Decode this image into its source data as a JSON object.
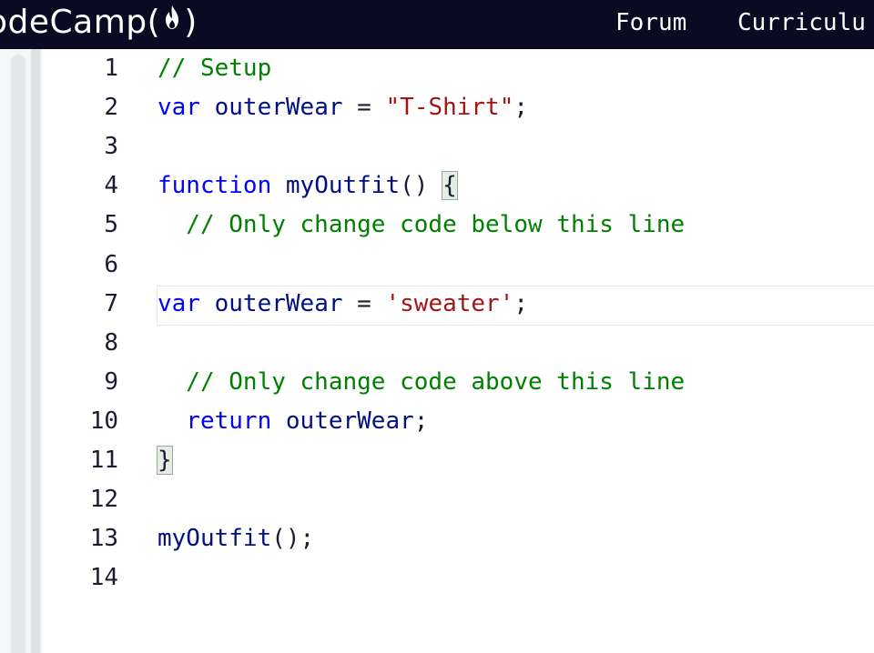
{
  "navbar": {
    "brand_text": "odeCamp(",
    "brand_close": ")",
    "links": [
      "Forum",
      "Curriculu"
    ]
  },
  "editor": {
    "lines": [
      {
        "num": "1",
        "tokens": [
          {
            "t": "// Setup",
            "c": "cmt"
          }
        ]
      },
      {
        "num": "2",
        "tokens": [
          {
            "t": "var",
            "c": "kw"
          },
          {
            "t": " ",
            "c": "punct"
          },
          {
            "t": "outerWear",
            "c": "def"
          },
          {
            "t": " = ",
            "c": "punct"
          },
          {
            "t": "\"T-Shirt\"",
            "c": "str"
          },
          {
            "t": ";",
            "c": "punct"
          }
        ]
      },
      {
        "num": "3",
        "tokens": []
      },
      {
        "num": "4",
        "tokens": [
          {
            "t": "function",
            "c": "kw"
          },
          {
            "t": " ",
            "c": "punct"
          },
          {
            "t": "myOutfit",
            "c": "def"
          },
          {
            "t": "() ",
            "c": "punct"
          },
          {
            "t": "{",
            "c": "brace"
          }
        ]
      },
      {
        "num": "5",
        "tokens": [
          {
            "t": "  // Only change code below this line",
            "c": "cmt"
          }
        ]
      },
      {
        "num": "6",
        "tokens": []
      },
      {
        "num": "7",
        "tokens": [
          {
            "t": "var",
            "c": "kw"
          },
          {
            "t": " ",
            "c": "punct"
          },
          {
            "t": "outerWear",
            "c": "def"
          },
          {
            "t": " = ",
            "c": "punct"
          },
          {
            "t": "'sweater'",
            "c": "str"
          },
          {
            "t": ";",
            "c": "punct"
          }
        ]
      },
      {
        "num": "8",
        "tokens": []
      },
      {
        "num": "9",
        "tokens": [
          {
            "t": "  // Only change code above this line",
            "c": "cmt"
          }
        ]
      },
      {
        "num": "10",
        "tokens": [
          {
            "t": "  ",
            "c": "punct"
          },
          {
            "t": "return",
            "c": "kw"
          },
          {
            "t": " ",
            "c": "punct"
          },
          {
            "t": "outerWear",
            "c": "def"
          },
          {
            "t": ";",
            "c": "punct"
          }
        ]
      },
      {
        "num": "11",
        "tokens": [
          {
            "t": "}",
            "c": "brace"
          }
        ]
      },
      {
        "num": "12",
        "tokens": []
      },
      {
        "num": "13",
        "tokens": [
          {
            "t": "myOutfit",
            "c": "def"
          },
          {
            "t": "();",
            "c": "punct"
          }
        ]
      },
      {
        "num": "14",
        "tokens": []
      }
    ]
  },
  "colors": {
    "navbar_bg": "#0a0a23",
    "keyword": "#0000ff",
    "identifier": "#001080",
    "string": "#a31515",
    "comment": "#008000"
  },
  "icons": {
    "brand_flame": "flame-icon"
  }
}
